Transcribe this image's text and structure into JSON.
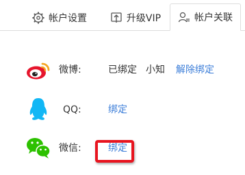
{
  "tabs": [
    {
      "label": "帐户设置",
      "icon": "gear-icon",
      "active": false
    },
    {
      "label": "升级VIP",
      "icon": "upgrade-icon",
      "active": false
    },
    {
      "label": "帐户关联",
      "icon": "user-link-icon",
      "active": true
    }
  ],
  "accounts": {
    "weibo": {
      "label": "微博:",
      "status": "已绑定",
      "nickname": "小知",
      "action": "解除绑定",
      "icon": "weibo-logo-icon"
    },
    "qq": {
      "label": "QQ:",
      "action": "绑定",
      "icon": "qq-logo-icon"
    },
    "wechat": {
      "label": "微信:",
      "action": "绑定",
      "icon": "wechat-logo-icon"
    }
  },
  "colors": {
    "link": "#3b7dd8",
    "highlight": "#e8141f",
    "weibo_red": "#e6162d",
    "weibo_orange": "#f5a623",
    "qq_blue": "#12b7f5",
    "wechat_green": "#2dc100"
  }
}
